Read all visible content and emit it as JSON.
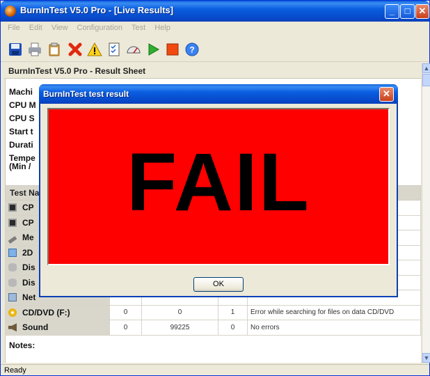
{
  "window": {
    "title": "BurnInTest V5.0 Pro - [Live Results]"
  },
  "menu": [
    "File",
    "Edit",
    "View",
    "Configuration",
    "Test",
    "Help"
  ],
  "toolbar_icons": [
    "save-icon",
    "print-icon",
    "clipboard-icon",
    "stop-x-icon",
    "warning-icon",
    "checklist-icon",
    "gauge-icon",
    "play-icon",
    "stop-icon",
    "help-icon"
  ],
  "sheet": {
    "header": "BurnInTest V5.0 Pro - Result Sheet",
    "info_labels": [
      "Machi",
      "CPU M",
      "CPU S",
      "Start t",
      "Durati",
      "Tempe",
      "(Min /"
    ]
  },
  "table": {
    "header_label": "Test Na",
    "rows": [
      {
        "name": "CP",
        "icon": "cpu-icon",
        "errors": "",
        "cycles": "",
        "ops": "",
        "msg": ""
      },
      {
        "name": "CP",
        "icon": "cpu-icon",
        "errors": "",
        "cycles": "",
        "ops": "",
        "msg": ""
      },
      {
        "name": "Me",
        "icon": "memory-icon",
        "errors": "",
        "cycles": "",
        "ops": "",
        "msg": ""
      },
      {
        "name": "2D",
        "icon": "monitor-icon",
        "errors": "",
        "cycles": "",
        "ops": "",
        "msg": ""
      },
      {
        "name": "Dis",
        "icon": "disk-icon",
        "errors": "",
        "cycles": "",
        "ops": "",
        "msg": ""
      },
      {
        "name": "Dis",
        "icon": "disk-icon",
        "errors": "",
        "cycles": "",
        "ops": "",
        "msg": ""
      },
      {
        "name": "Net",
        "icon": "network-icon",
        "errors": "",
        "cycles": "",
        "ops": "",
        "msg": ""
      },
      {
        "name": "CD/DVD (F:)",
        "icon": "cd-icon",
        "errors": "0",
        "cycles": "0",
        "ops": "1",
        "msg": "Error while searching for files on data CD/DVD"
      },
      {
        "name": "Sound",
        "icon": "speaker-icon",
        "errors": "0",
        "cycles": "99225",
        "ops": "0",
        "msg": "No errors"
      }
    ]
  },
  "notes_label": "Notes:",
  "status": "Ready",
  "dialog": {
    "title": "BurnInTest test result",
    "result_text": "FAIL",
    "ok_label": "OK",
    "result_color": "#ff0000"
  }
}
